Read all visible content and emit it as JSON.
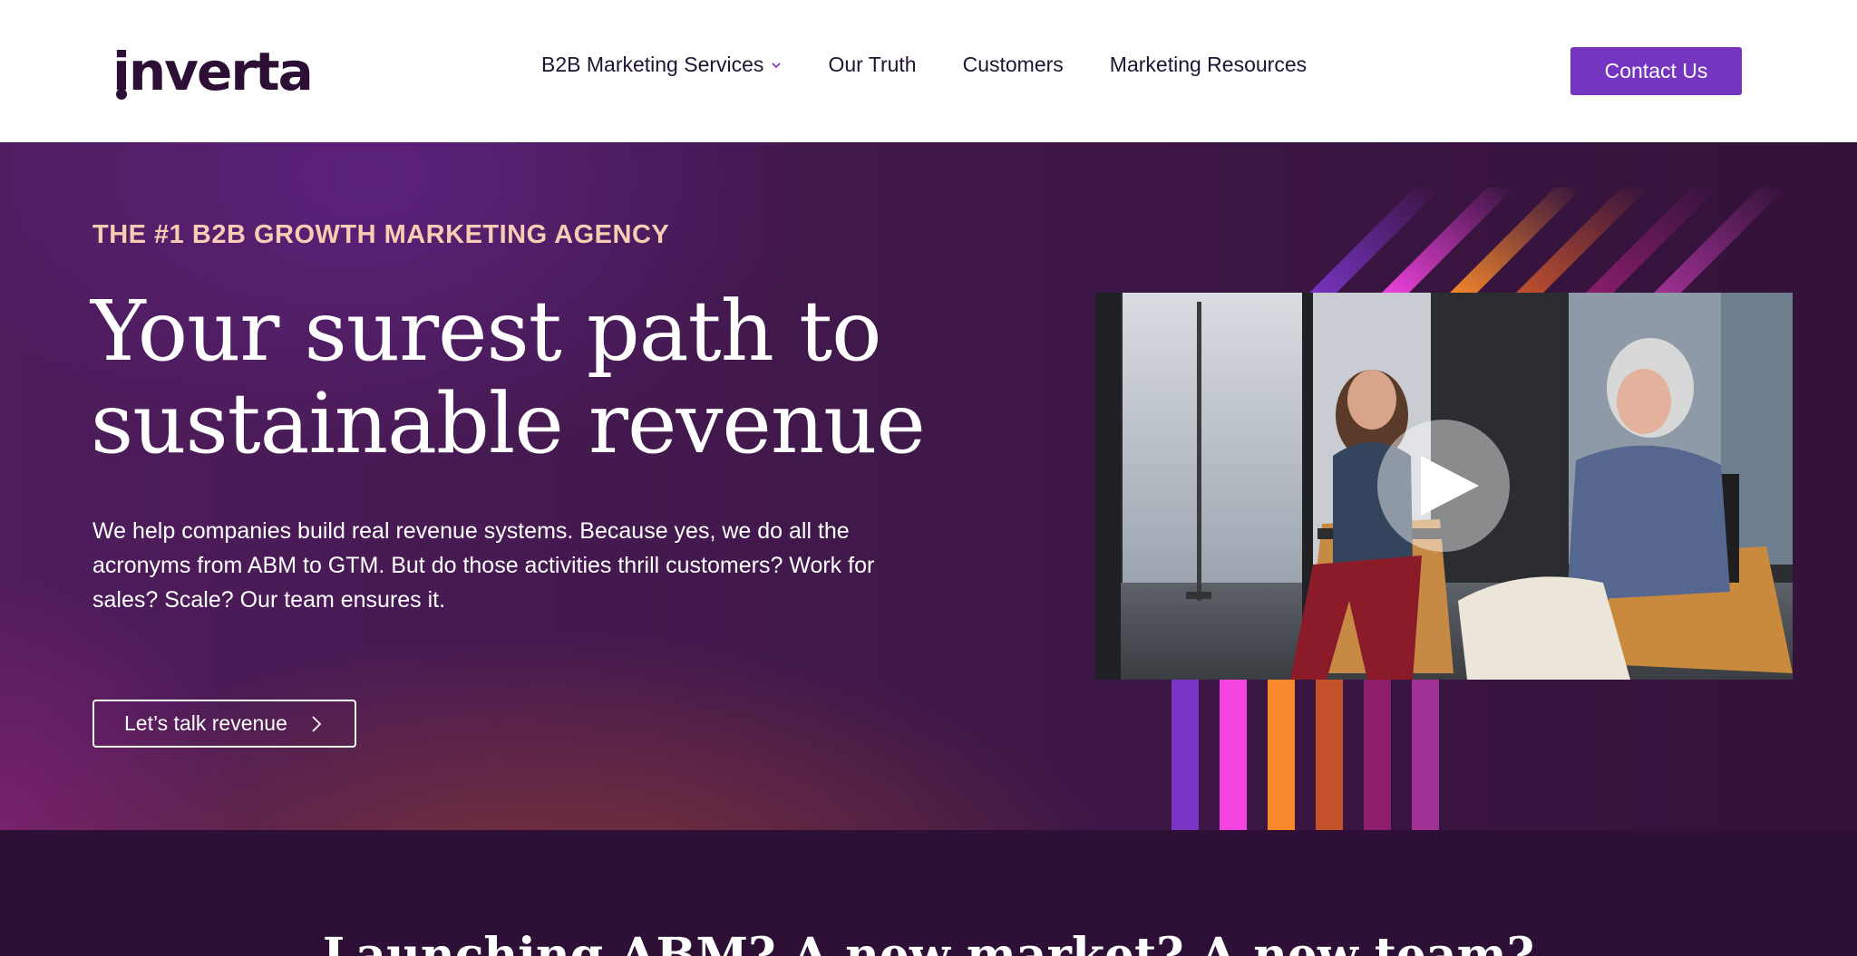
{
  "header": {
    "logo_text": "inverta",
    "nav": [
      {
        "label": "B2B Marketing Services",
        "has_dropdown": true
      },
      {
        "label": "Our Truth"
      },
      {
        "label": "Customers"
      },
      {
        "label": "Marketing Resources"
      }
    ],
    "contact_label": "Contact Us"
  },
  "hero": {
    "eyebrow": "THE #1 B2B GROWTH MARKETING AGENCY",
    "headline_line1": "Your surest path to",
    "headline_line2": "sustainable revenue",
    "intro": "We help companies build real revenue systems. Because yes, we do all the acronyms from ABM to GTM. But do those activities thrill customers? Work for sales? Scale? Our team ensures it.",
    "cta_label": "Let’s talk revenue",
    "video": {
      "play_icon": "play-icon"
    }
  },
  "next_section": {
    "title": "Launching ABM? A new market? A new team?"
  },
  "colors": {
    "brand_purple": "#7535c1",
    "dark_plum": "#2e0f36",
    "eyebrow_peach": "#f7cdb4",
    "stripe_colors": [
      "#7a34c4",
      "#f443e0",
      "#f7892b",
      "#c4532c",
      "#8c1e6d",
      "#a33297"
    ]
  }
}
